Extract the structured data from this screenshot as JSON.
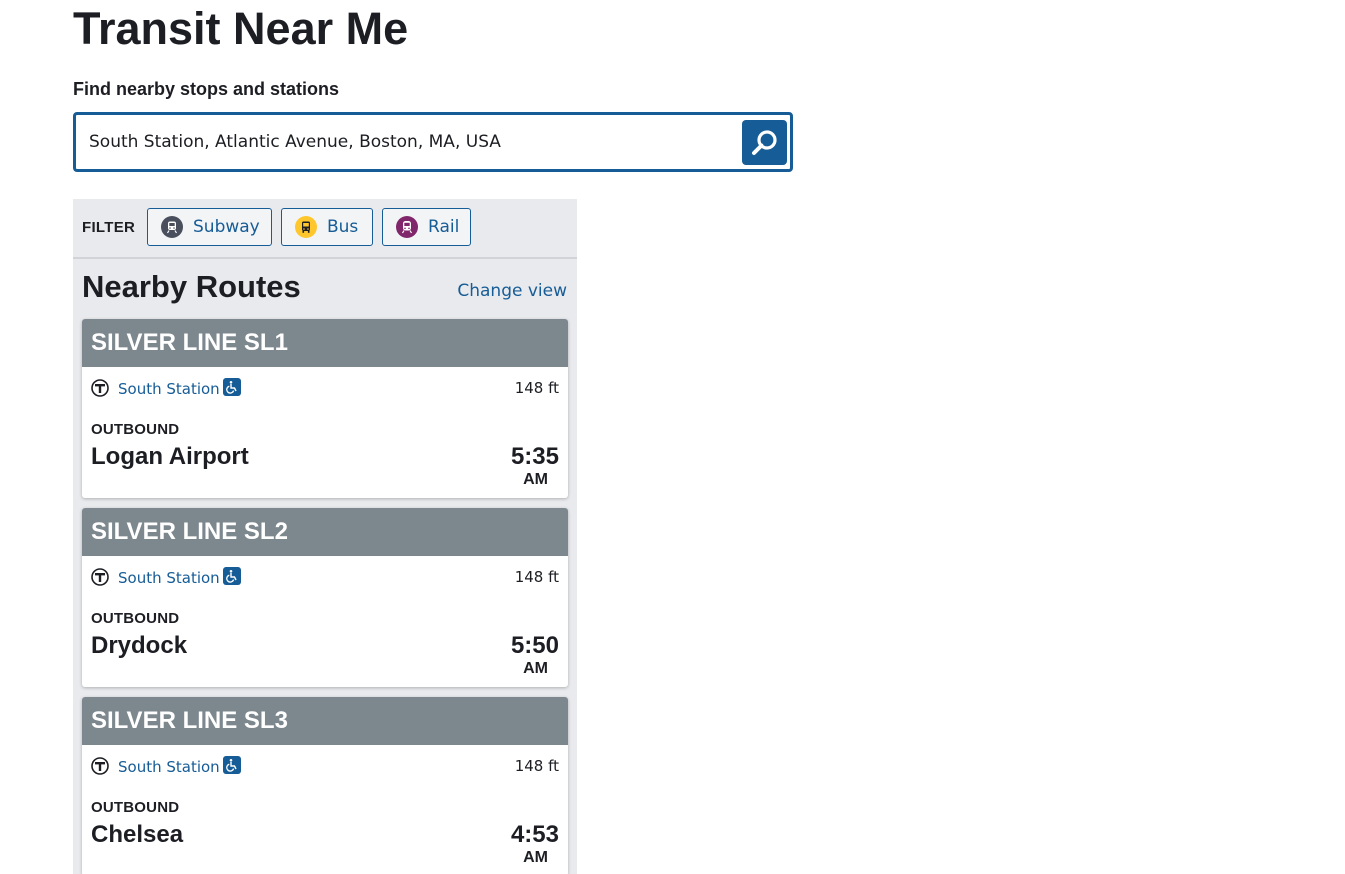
{
  "page": {
    "title": "Transit Near Me"
  },
  "search": {
    "label": "Find nearby stops and stations",
    "value": "South Station, Atlantic Avenue, Boston, MA, USA",
    "button_icon": "search-icon"
  },
  "filter": {
    "label": "FILTER",
    "options": [
      {
        "label": "Subway",
        "icon": "subway-icon",
        "color": "#494f5c"
      },
      {
        "label": "Bus",
        "icon": "bus-icon",
        "color": "#ffc72c"
      },
      {
        "label": "Rail",
        "icon": "commuter-rail-icon",
        "color": "#80276c"
      }
    ]
  },
  "routes": {
    "heading": "Nearby Routes",
    "change_view": "Change view",
    "items": [
      {
        "name": "SILVER LINE SL1",
        "stop": "South Station",
        "distance": "148 ft",
        "direction": "OUTBOUND",
        "headsign": "Logan Airport",
        "time": "5:35",
        "ampm": "AM"
      },
      {
        "name": "SILVER LINE SL2",
        "stop": "South Station",
        "distance": "148 ft",
        "direction": "OUTBOUND",
        "headsign": "Drydock",
        "time": "5:50",
        "ampm": "AM"
      },
      {
        "name": "SILVER LINE SL3",
        "stop": "South Station",
        "distance": "148 ft",
        "direction": "OUTBOUND",
        "headsign": "Chelsea",
        "time": "4:53",
        "ampm": "AM"
      }
    ]
  },
  "colors": {
    "accent": "#165c96",
    "route_header": "#7c878e",
    "panel_bg": "#e9eaed"
  }
}
